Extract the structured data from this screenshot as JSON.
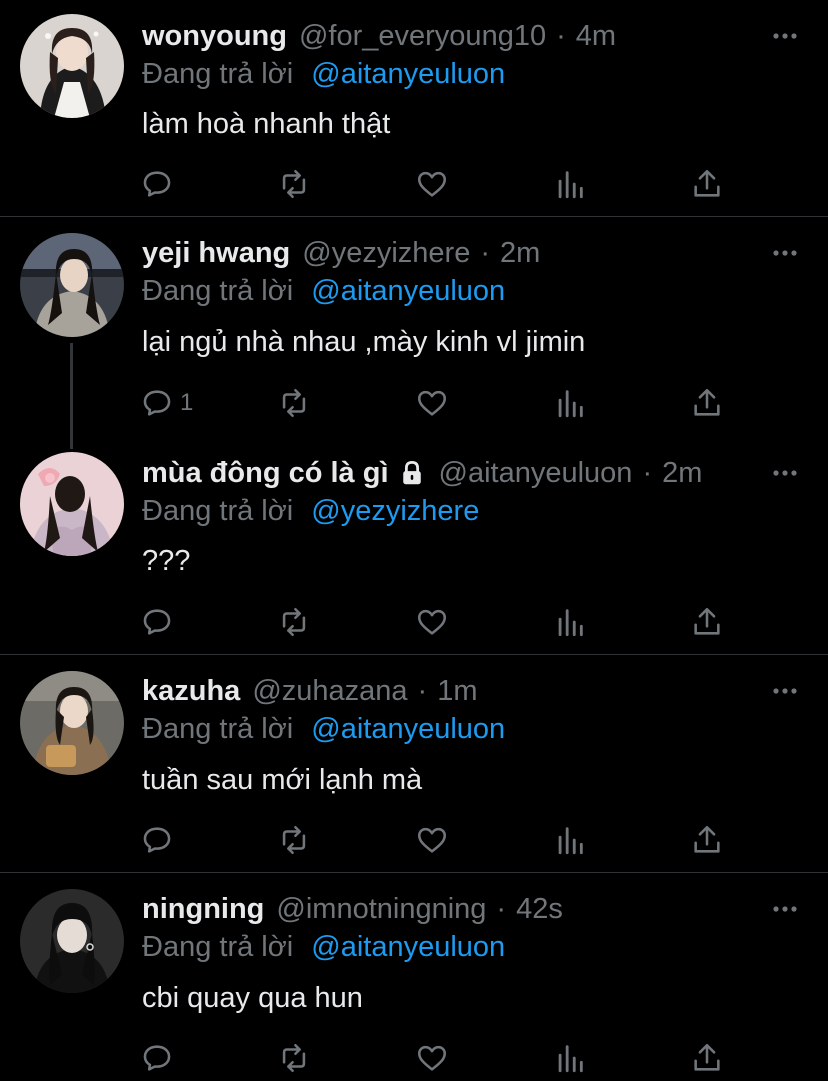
{
  "tweets": [
    {
      "name": "wonyoung",
      "handle": "@for_everyoung10",
      "time": "4m",
      "reply_prefix": "Đang trả lời",
      "reply_to": "@aitanyeuluon",
      "text": "làm hoà nhanh thật",
      "reply_count": "",
      "locked": false
    },
    {
      "name": "yeji hwang",
      "handle": "@yezyizhere",
      "time": "2m",
      "reply_prefix": "Đang trả lời",
      "reply_to": "@aitanyeuluon",
      "text": "lại ngủ nhà nhau ,mày kinh vl jimin",
      "reply_count": "1",
      "locked": false
    },
    {
      "name": "mùa đông có là gì",
      "handle": "@aitanyeuluon",
      "time": "2m",
      "reply_prefix": "Đang trả lời",
      "reply_to": "@yezyizhere",
      "text": "???",
      "reply_count": "",
      "locked": true
    },
    {
      "name": "kazuha",
      "handle": "@zuhazana",
      "time": "1m",
      "reply_prefix": "Đang trả lời",
      "reply_to": "@aitanyeuluon",
      "text": "tuần sau mới lạnh mà",
      "reply_count": "",
      "locked": false
    },
    {
      "name": "ningning",
      "handle": "@imnotningning",
      "time": "42s",
      "reply_prefix": "Đang trả lời",
      "reply_to": "@aitanyeuluon",
      "text": "cbi quay qua hun",
      "reply_count": "",
      "locked": false
    }
  ],
  "separator": "·",
  "colors": {
    "background": "#000000",
    "text": "#e7e9ea",
    "muted": "#71767b",
    "accent": "#1d9bf0",
    "divider": "#2f3336"
  },
  "icons": [
    "reply-icon",
    "retweet-icon",
    "like-icon",
    "views-icon",
    "share-icon",
    "more-icon",
    "lock-icon"
  ]
}
